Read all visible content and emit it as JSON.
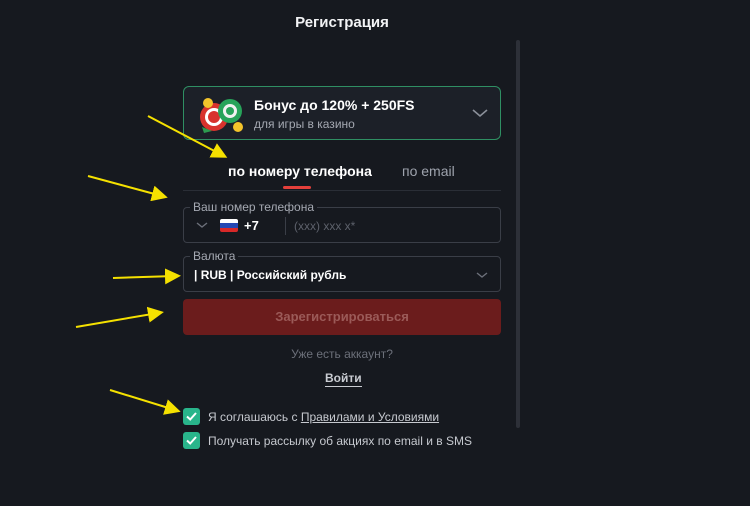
{
  "header": {
    "title": "Регистрация"
  },
  "bonus": {
    "title": "Бонус до 120% + 250FS",
    "subtitle": "для игры в казино",
    "icon": "casino-chips-icon"
  },
  "tabs": [
    {
      "label": "по номеру телефона",
      "active": true
    },
    {
      "label": "по email",
      "active": false
    }
  ],
  "phone_field": {
    "legend": "Ваш номер телефона",
    "country_flag": "russia-flag-icon",
    "country_code": "+7",
    "value": "",
    "placeholder": "(xxx) xxx x*"
  },
  "currency_field": {
    "legend": "Валюта",
    "value": "| RUB | Российский рубль"
  },
  "register_button": {
    "label": "Зарегистрироваться"
  },
  "have_account_text": "Уже есть аккаунт?",
  "login_link": "Войти",
  "agreements": [
    {
      "prefix": "Я соглашаюсь с ",
      "link": "Правилами и Условиями",
      "checked": true
    },
    {
      "text": "Получать рассылку об акциях по email и в SMS",
      "checked": true
    }
  ],
  "colors": {
    "background": "#16191f",
    "accent_red": "#e5403b",
    "button_disabled": "#6b1c1c",
    "checkbox_green": "#29b58b",
    "bonus_border": "#2f8f63",
    "annotation_arrow": "#f5e100"
  }
}
